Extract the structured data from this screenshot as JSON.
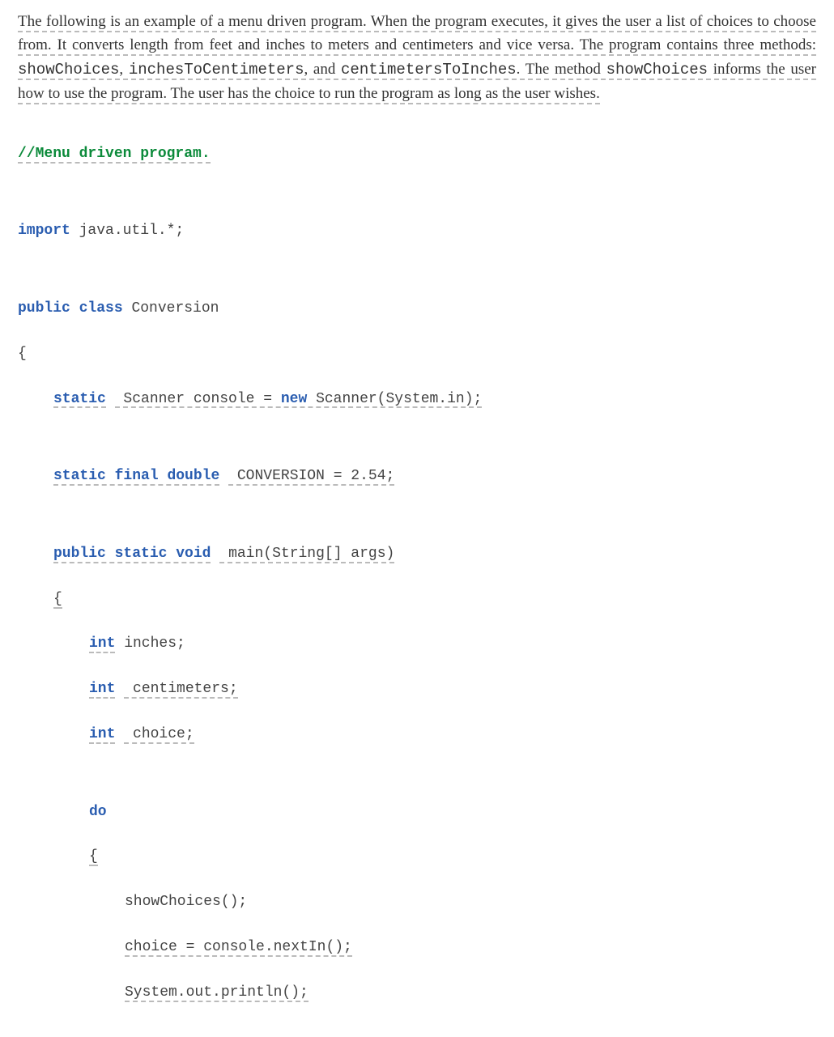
{
  "description": {
    "parts": [
      {
        "text": "The following is an example of a menu driven program. When the program executes, it gives the user a list of choices to choose from. It converts length from feet and inches to meters and centimeters and vice versa. The program contains three methods: ",
        "mono": false
      },
      {
        "text": "showChoices",
        "mono": true
      },
      {
        "text": ", ",
        "mono": false
      },
      {
        "text": "inchesToCentimeters",
        "mono": true
      },
      {
        "text": ", and ",
        "mono": false
      },
      {
        "text": "centimetersToInches",
        "mono": true
      },
      {
        "text": ". The method ",
        "mono": false
      },
      {
        "text": "showChoices",
        "mono": true
      },
      {
        "text": " informs the user how to use the program. The user has the choice to run the program as long as the user wishes.",
        "mono": false
      }
    ]
  },
  "code": {
    "comment": "//Menu driven program.",
    "import_kw": "import",
    "import_rest": " java.util.*;",
    "class_decl": {
      "public": "public",
      "class": "class",
      "name": " Conversion"
    },
    "open_brace": "{",
    "scanner_line": {
      "static": "static",
      "rest1": " Scanner console = ",
      "new": "new",
      "rest2": " Scanner(System.in);"
    },
    "constant_line": {
      "static": "static",
      "final": "final",
      "double": "double",
      "rest": " CONVERSION = 2.54;"
    },
    "main_decl": {
      "public": "public",
      "static": "static",
      "void": "void",
      "rest": " main(String[] args)"
    },
    "main_open": "{",
    "v1": {
      "int": "int",
      "name": " inches;"
    },
    "v2": {
      "int": "int",
      "name": " centimeters;"
    },
    "v3": {
      "int": "int",
      "name": " choice;"
    },
    "do_kw": "do",
    "do_open": "{",
    "s1": "showChoices();",
    "s2": "choice = console.nextIn();",
    "s3": "System.out.println();"
  }
}
